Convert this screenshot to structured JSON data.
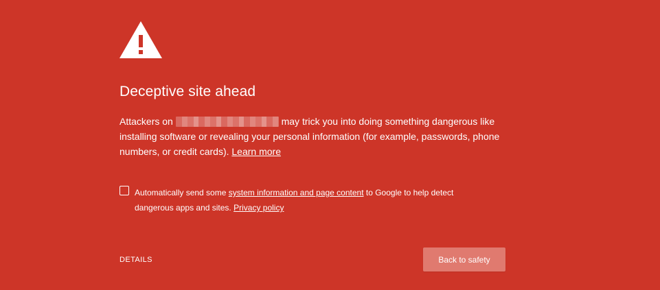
{
  "icon": {
    "name": "warning-triangle-icon",
    "color": "#ffffff"
  },
  "title": "Deceptive site ahead",
  "description": {
    "prefix": "Attackers on",
    "suffix": "may trick you into doing something dangerous like installing software or revealing your personal information (for example, passwords, phone numbers, or credit cards).",
    "learn_more": "Learn more"
  },
  "reporting": {
    "checked": false,
    "prefix": "Automatically send some",
    "link": "system information and page content",
    "middle": "to Google to help detect dangerous apps and sites.",
    "privacy_link": "Privacy policy"
  },
  "actions": {
    "details_label": "DETAILS",
    "back_label": "Back to safety"
  },
  "colors": {
    "background": "#cd3528",
    "primary_button": "#e07a6f",
    "text": "#ffffff"
  }
}
